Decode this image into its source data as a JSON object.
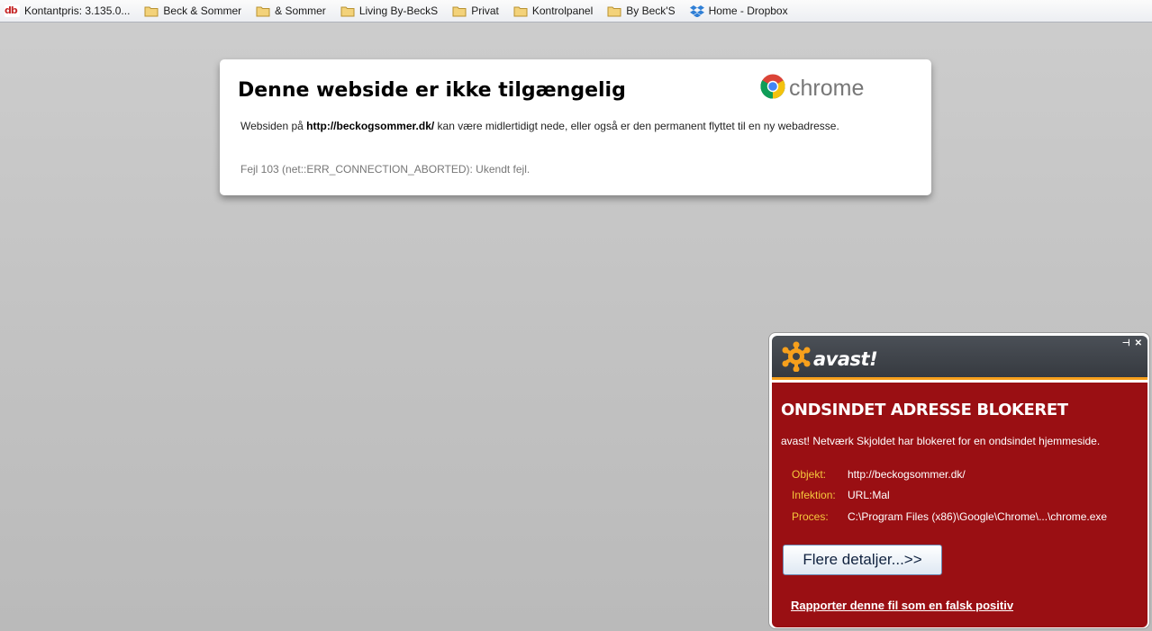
{
  "bookmarks": [
    {
      "label": "Kontantpris: 3.135.0...",
      "icon": "db-icon"
    },
    {
      "label": "Beck & Sommer",
      "icon": "folder-icon"
    },
    {
      "label": "& Sommer",
      "icon": "folder-icon"
    },
    {
      "label": "Living By-BeckS",
      "icon": "folder-icon"
    },
    {
      "label": "Privat",
      "icon": "folder-icon"
    },
    {
      "label": "Kontrolpanel",
      "icon": "folder-icon"
    },
    {
      "label": "By Beck'S",
      "icon": "folder-icon"
    },
    {
      "label": "Home - Dropbox",
      "icon": "dropbox-icon"
    }
  ],
  "db_icon_text": "db",
  "error": {
    "title": "Denne webside er ikke tilgængelig",
    "brand": "chrome",
    "msg_prefix": "Websiden på ",
    "url": "http://beckogsommer.dk/",
    "msg_suffix": " kan være midlertidigt nede, eller også er den permanent flyttet til en ny webadresse.",
    "code": "Fejl 103 (net::ERR_CONNECTION_ABORTED): Ukendt fejl."
  },
  "avast": {
    "brand": "avast!",
    "title": "ONDSINDET ADRESSE BLOKERET",
    "description": "avast! Netværk Skjoldet har blokeret for en ondsindet hjemmeside.",
    "rows": [
      {
        "key": "Objekt:",
        "value": "http://beckogsommer.dk/"
      },
      {
        "key": "Infektion:",
        "value": "URL:Mal"
      },
      {
        "key": "Proces:",
        "value": "C:\\Program Files (x86)\\Google\\Chrome\\...\\chrome.exe"
      }
    ],
    "details_button": "Flere detaljer...>>",
    "report_link": "Rapporter denne fil som en falsk positiv",
    "pin_glyph": "⊣",
    "close_glyph": "✕"
  },
  "colors": {
    "avast_red": "#9a0f13",
    "avast_orange": "#f7a01c",
    "avast_label": "#f5c83c"
  }
}
